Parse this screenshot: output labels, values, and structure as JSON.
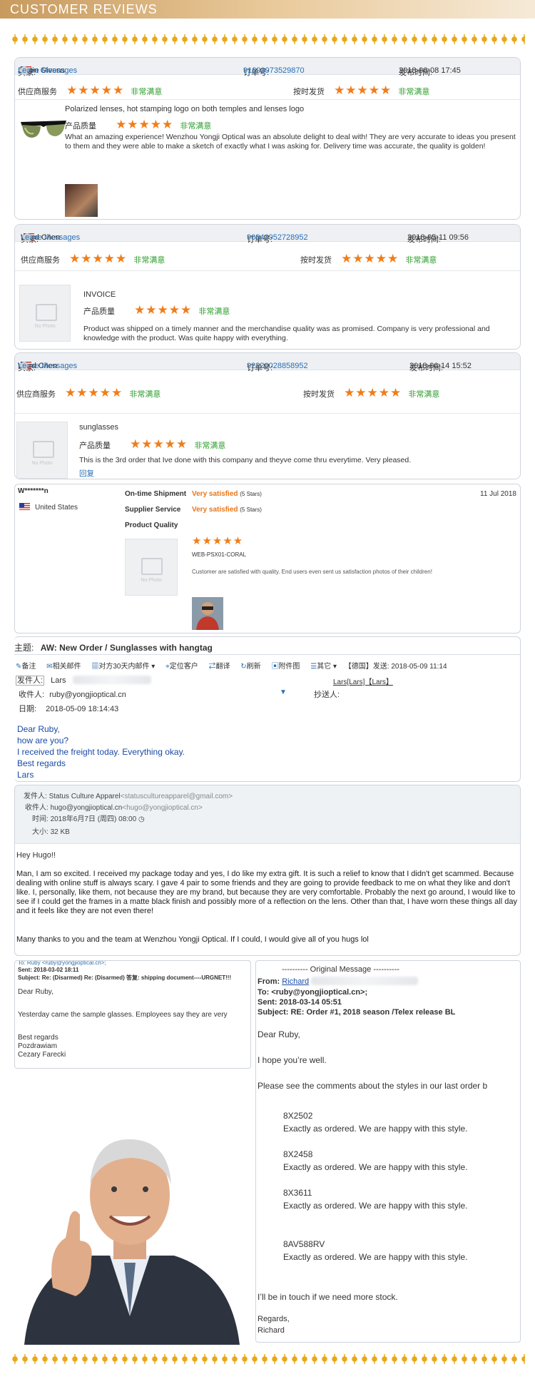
{
  "header": {
    "title": "CUSTOMER REVIEWS"
  },
  "colors": {
    "star": "#f07d1a",
    "satisfied": "#2e9e2e",
    "link": "#2a6fb5",
    "header_gold": "#c89a5e"
  },
  "stars_text": "★★★★★",
  "review1": {
    "buyer_label": "买家:",
    "buyer": "Justin Givens",
    "msg": "Leave Messages",
    "order_label": "订单号:",
    "order": "91893973529870",
    "time_label": "发布时间:",
    "time": "2018-06-08 17:45",
    "service_label": "供应商服务",
    "service_rating": "非常满意",
    "ship_label": "按时发货",
    "ship_rating": "非常满意",
    "product": "Polarized lenses, hot stamping logo on both temples and lenses logo",
    "quality_label": "产品质量",
    "quality_rating": "非常满意",
    "text": "What an amazing experience! Wenzhou Yongji Optical was an absolute delight to deal with! They are very accurate to ideas you present to them and they were able to make a sketch of exactly what I was asking for. Delivery time was accurate, the quality is golden!"
  },
  "review2": {
    "buyer_label": "买家:",
    "buyer": "Ward Chen",
    "msg": "Leave Messages",
    "order_label": "订单号:",
    "order": "90843952728952",
    "time_label": "发布时间:",
    "time": "2018-05-11 09:56",
    "service_label": "供应商服务",
    "service_rating": "非常满意",
    "ship_label": "按时发货",
    "ship_rating": "非常满意",
    "product": "INVOICE",
    "no_photo": "No Photo",
    "quality_label": "产品质量",
    "quality_rating": "非常满意",
    "text": "Product was shipped on a timely manner and the merchandise quality was as promised. Company is very professional and knowledge with the product. Was quite happy with everything."
  },
  "review3": {
    "buyer_label": "买家:",
    "buyer": "Ward Chen",
    "msg": "Leave Messages",
    "order_label": "订单号:",
    "order": "92220028858952",
    "time_label": "发布时间:",
    "time": "2018-06-14 15:52",
    "service_label": "供应商服务",
    "service_rating": "非常满意",
    "ship_label": "按时发货",
    "ship_rating": "非常满意",
    "product": "sunglasses",
    "no_photo": "No Photo",
    "quality_label": "产品质量",
    "quality_rating": "非常满意",
    "text": "This is the 3rd order that Ive done with this company and theyve come thru everytime. Very pleased.",
    "reply": "回复"
  },
  "review4": {
    "user": "W*******n",
    "country": "United States",
    "date": "11 Jul 2018",
    "shipment_label": "On-time Shipment",
    "shipment_value": "Very satisfied",
    "shipment_stars": "(5 Stars)",
    "supplier_label": "Supplier Service",
    "supplier_value": "Very satisfied",
    "supplier_stars": "(5 Stars)",
    "quality_label": "Product Quality",
    "sku": "WEB-PSX01-CORAL",
    "no_photo": "No Photo",
    "text": "Customer are satisfied with quality. End users even sent us satisfaction photos of their children!"
  },
  "email1": {
    "subject_label": "主题:",
    "subject": "AW: New Order / Sunglasses with hangtag",
    "toolbar": [
      "备注",
      "相关邮件",
      "对方30天内邮件",
      "定位客户",
      "翻译",
      "刷新",
      "附件图",
      "其它"
    ],
    "sent_info": "【德国】发送: 2018-05-09 11:14",
    "from_label": "发件人:",
    "from": "Lars",
    "from_right": "Lars[Lars]【Lars】",
    "to_label": "收件人:",
    "to": "ruby@yongjioptical.cn",
    "cc_label": "抄送人:",
    "date_label": "日期:",
    "date": "2018-05-09 18:14:43",
    "body": [
      "Dear Ruby,",
      "how are you?",
      "I received the freight today. Everything okay.",
      "Best regards",
      "Lars"
    ]
  },
  "email2": {
    "from_label": "发件人:",
    "from": "Status Culture Apparel",
    "from_addr": "<statuscultureapparel@gmail.com>",
    "to_label": "收件人:",
    "to": "hugo@yongjioptical.cn",
    "to_addr": "<hugo@yongjioptical.cn>",
    "time_label": "时间:",
    "time": "2018年6月7日 (周四) 08:00",
    "size_label": "大小:",
    "size": "32 KB",
    "greeting": "Hey Hugo!!",
    "p1": "Man, I am so excited. I received my package today and yes, I do like my extra gift. It is such a relief to know that I didn't get scammed. Because dealing with online stuff is always scary. I gave 4 pair to some friends and they are going to provide feedback to me on what they like and don't like. I, personally, like them, not because they are my brand, but because they are very comfortable. Probably the next go around, I would like to see if I could get the frames in a matte black finish and possibly more of a reflection on the lens. Other than that, I have worn these things all day and it feels like they are not even there!",
    "p2": "Many thanks to you and the team at Wenzhou Yongji Optical. If I could, I would give all of you hugs lol"
  },
  "email3": {
    "to_line": "To: Ruby <ruby@yongjioptical.cn>;",
    "sent": "Sent: 2018-03-02 18:11",
    "subject": "Subject: Re: (Disarmed) Re: (Disarmed) 答复: shipping document----URGNET!!!",
    "greeting": "Dear Ruby,",
    "body": "Yesterday came the sample glasses.  Employees say they are very",
    "sign": [
      "Best regards",
      "Pozdrawiam",
      "Cezary Farecki"
    ]
  },
  "email4": {
    "header": "---------- Original Message ----------",
    "from_label": "From:",
    "from": "Richard",
    "to": "To: <ruby@yongjioptical.cn>;",
    "sent": "Sent: 2018-03-14 05:51",
    "subject": "Subject: RE: Order #1, 2018 season /Telex release BL",
    "greeting": "Dear Ruby,",
    "line1": "I hope you’re well.",
    "line2": "Please see the comments about the styles in our last order b",
    "styles": [
      {
        "code": "8X2502",
        "comment": "Exactly as ordered. We are happy with this style."
      },
      {
        "code": "8X2458",
        "comment": "Exactly as ordered. We are happy with this style."
      },
      {
        "code": "8X3611",
        "comment": "Exactly as ordered. We are happy with this style."
      },
      {
        "code": "8AV588RV",
        "comment": "Exactly as ordered. We are happy with this style."
      }
    ],
    "closing": "I’ll be in touch if we need more stock.",
    "regards": "Regards,",
    "name": "Richard"
  }
}
